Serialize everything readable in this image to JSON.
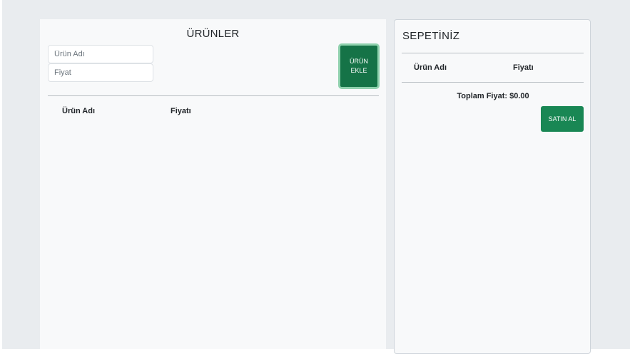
{
  "products": {
    "title": "ÜRÜNLER",
    "name_placeholder": "Ürün Adı",
    "price_placeholder": "Fiyat",
    "add_button_line1": "ÜRÜN",
    "add_button_line2": "EKLE",
    "columns": [
      "Ürün Adı",
      "Fiyatı"
    ]
  },
  "cart": {
    "title": "SEPETİNİZ",
    "columns": [
      "Ürün Adı",
      "Fiyatı"
    ],
    "total_text": "Toplam Fiyat: $0.00",
    "buy_button": "SATIN AL"
  },
  "colors": {
    "page_bg": "#e9ecef",
    "panel_bg": "#f8f9fa",
    "button_green": "#198754",
    "add_button_focus_ring": "#8fd1ad"
  }
}
